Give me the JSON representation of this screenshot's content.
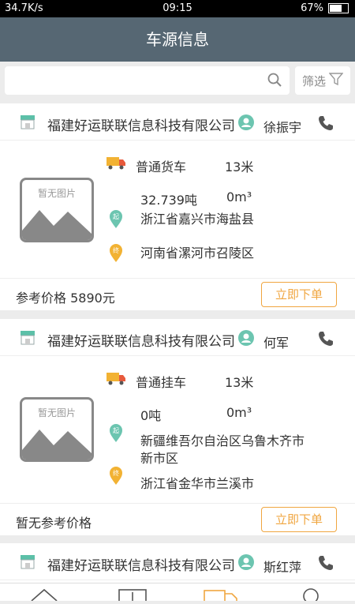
{
  "status": {
    "left": "34.7K/s",
    "time": "09:15",
    "battery": "67%",
    "battery_level": 0.67
  },
  "header": {
    "title": "车源信息"
  },
  "search": {
    "placeholder": "",
    "filter_label": "筛选"
  },
  "no_image_label": "暂无图片",
  "order_label": "立即下单",
  "cards": [
    {
      "company": "福建好运联联信息科技有限公司",
      "contact": "徐振宇",
      "truck_type": "普通货车",
      "length": "13米",
      "weight": "32.739吨",
      "volume": "0m³",
      "origin": "浙江省嘉兴市海盐县",
      "destination": "河南省漯河市召陵区",
      "price": "参考价格 5890元"
    },
    {
      "company": "福建好运联联信息科技有限公司",
      "contact": "何军",
      "truck_type": "普通挂车",
      "length": "13米",
      "weight": "0吨",
      "volume": "0m³",
      "origin": "新疆维吾尔自治区乌鲁木齐市新市区",
      "destination": "浙江省金华市兰溪市",
      "price": "暂无参考价格"
    },
    {
      "company": "福建好运联联信息科技有限公司",
      "contact": "斯红萍"
    }
  ],
  "pin_labels": {
    "origin": "起",
    "destination": "终"
  }
}
